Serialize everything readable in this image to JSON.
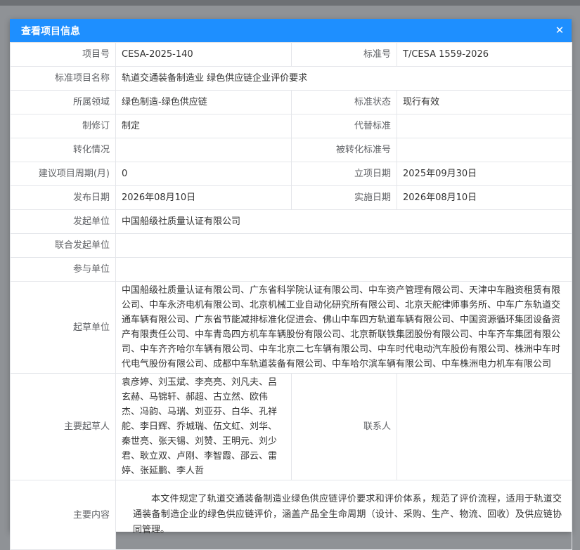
{
  "dialog": {
    "title": "查看项目信息",
    "close_icon": "close-icon"
  },
  "fields": {
    "project_no_label": "项目号",
    "project_no": "CESA-2025-140",
    "standard_no_label": "标准号",
    "standard_no": "T/CESA 1559-2026",
    "standard_name_label": "标准项目名称",
    "standard_name": "轨道交通装备制造业 绿色供应链企业评价要求",
    "domain_label": "所属领域",
    "domain": "绿色制造-绿色供应链",
    "status_label": "标准状态",
    "status": "现行有效",
    "revision_label": "制修订",
    "revision": "制定",
    "replace_label": "代替标准",
    "replace": "",
    "conversion_label": "转化情况",
    "conversion": "",
    "converted_no_label": "被转化标准号",
    "converted_no": "",
    "period_label": "建议项目周期(月)",
    "period": "0",
    "approval_date_label": "立项日期",
    "approval_date": "2025年09月30日",
    "publish_date_label": "发布日期",
    "publish_date": "2026年08月10日",
    "implement_date_label": "实施日期",
    "implement_date": "2026年08月10日",
    "initiator_label": "发起单位",
    "initiator": "中国船级社质量认证有限公司",
    "co_initiator_label": "联合发起单位",
    "co_initiator": "",
    "participant_label": "参与单位",
    "participant": "",
    "drafting_units_label": "起草单位",
    "drafting_units": "中国船级社质量认证有限公司、广东省科学院认证有限公司、中车资产管理有限公司、天津中车融资租赁有限公司、中车永济电机有限公司、北京机械工业自动化研究所有限公司、北京天舵律师事务所、中车广东轨道交通车辆有限公司、广东省节能减排标准化促进会、佛山中车四方轨道车辆有限公司、中国资源循环集团设备资产有限责任公司、中车青岛四方机车车辆股份有限公司、北京新联铁集团股份有限公司、中车齐车集团有限公司、中车齐齐哈尔车辆有限公司、中车北京二七车辆有限公司、中车时代电动汽车股份有限公司、株洲中车时代电气股份有限公司、成都中车轨道装备有限公司、中车哈尔滨车辆有限公司、中车株洲电力机车有限公司",
    "drafters_label": "主要起草人",
    "drafters": "袁彦婷、刘玉斌、李亮亮、刘凡夫、吕玄赫、马锦轩、郝超、古立然、欧伟杰、冯韵、马瑞、刘亚芬、白华、孔祥舵、李日辉、乔城瑞、伍文虹、刘华、秦世亮、张天锡、刘赞、王明元、刘少君、耿立双、卢刚、李智霞、邵云、雷婷、张延鹏、李人哲",
    "contact_label": "联系人",
    "contact": "",
    "main_content_label": "主要内容",
    "main_content": "本文件规定了轨道交通装备制造业绿色供应链评价要求和评价体系，规范了评价流程，适用于轨道交通装备制造企业的绿色供应链评价，涵盖产品全生命周期（设计、采购、生产、物流、回收）及供应链协同管理。"
  },
  "colors": {
    "header": "#1e8fff",
    "border": "#e4e6ea",
    "label_text": "#606266"
  }
}
